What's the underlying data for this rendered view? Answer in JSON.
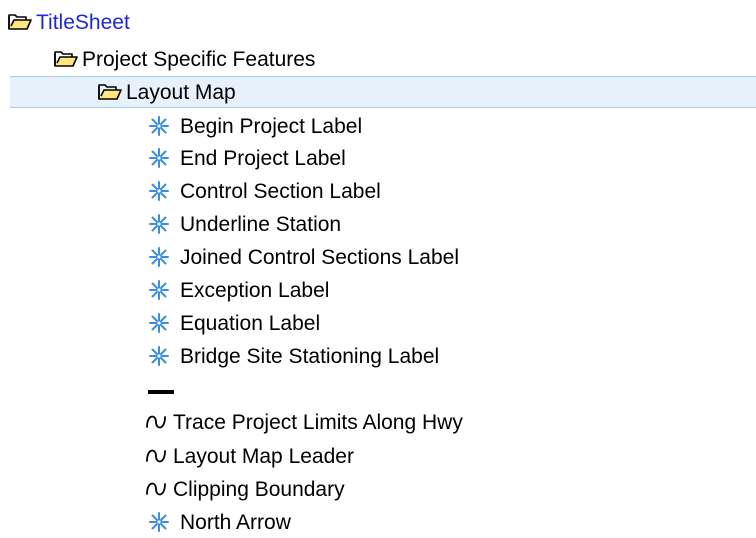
{
  "tree": {
    "root": {
      "label": "TitleSheet",
      "icon": "folder-open-icon"
    },
    "group": {
      "label": "Project Specific Features",
      "icon": "folder-open-icon"
    },
    "subgroup": {
      "label": "Layout Map",
      "icon": "folder-open-icon",
      "selected": true
    },
    "features": [
      {
        "label": "Begin Project Label",
        "icon": "point-feature-icon"
      },
      {
        "label": "End Project Label",
        "icon": "point-feature-icon"
      },
      {
        "label": "Control Section Label",
        "icon": "point-feature-icon"
      },
      {
        "label": "Underline Station",
        "icon": "point-feature-icon"
      },
      {
        "label": "Joined Control Sections Label",
        "icon": "point-feature-icon"
      },
      {
        "label": "Exception Label",
        "icon": "point-feature-icon"
      },
      {
        "label": "Equation Label",
        "icon": "point-feature-icon"
      },
      {
        "label": "Bridge Site Stationing Label",
        "icon": "point-feature-icon"
      }
    ],
    "separator_icon": "line-feature-icon",
    "linear_features": [
      {
        "label": "Trace Project Limits Along Hwy",
        "icon": "linear-feature-icon"
      },
      {
        "label": "Layout Map Leader",
        "icon": "linear-feature-icon"
      },
      {
        "label": "Clipping Boundary",
        "icon": "linear-feature-icon"
      }
    ],
    "last_feature": {
      "label": "North Arrow",
      "icon": "point-feature-icon"
    },
    "colors": {
      "root_text": "#1f27d6",
      "selection_bg": "#e6f1fb",
      "selection_border": "#a7cfef",
      "feature_icon": "#3a8de0"
    }
  }
}
